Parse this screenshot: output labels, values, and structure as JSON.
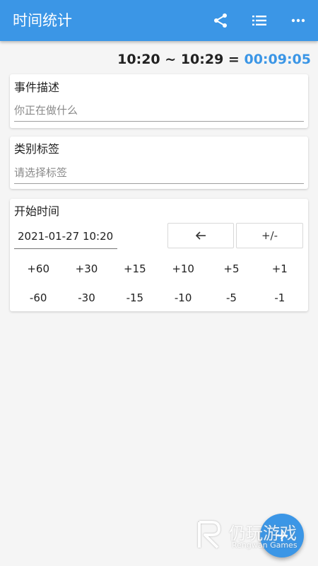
{
  "appbar": {
    "title": "时间统计",
    "icons": [
      "share-icon",
      "list-icon",
      "more-icon"
    ],
    "color": "#3b96e6"
  },
  "summary": {
    "start": "10:20",
    "tilde": "~",
    "end": "10:29",
    "equals": "=",
    "duration": "00:09:05",
    "duration_color": "#3b96e6"
  },
  "event": {
    "label": "事件描述",
    "placeholder": "你正在做什么"
  },
  "category": {
    "label": "类别标签",
    "placeholder": "请选择标签"
  },
  "start_time": {
    "label": "开始时间",
    "value": "2021-01-27 10:20",
    "back_icon": "arrow-left-icon",
    "sign_label": "+/-",
    "plus": [
      "+60",
      "+30",
      "+15",
      "+10",
      "+5",
      "+1"
    ],
    "minus": [
      "-60",
      "-30",
      "-15",
      "-10",
      "-5",
      "-1"
    ]
  },
  "fab": {
    "icon": "plus-icon"
  },
  "watermark": {
    "text": "仍玩游戏",
    "sub": "Rengwan Games"
  }
}
